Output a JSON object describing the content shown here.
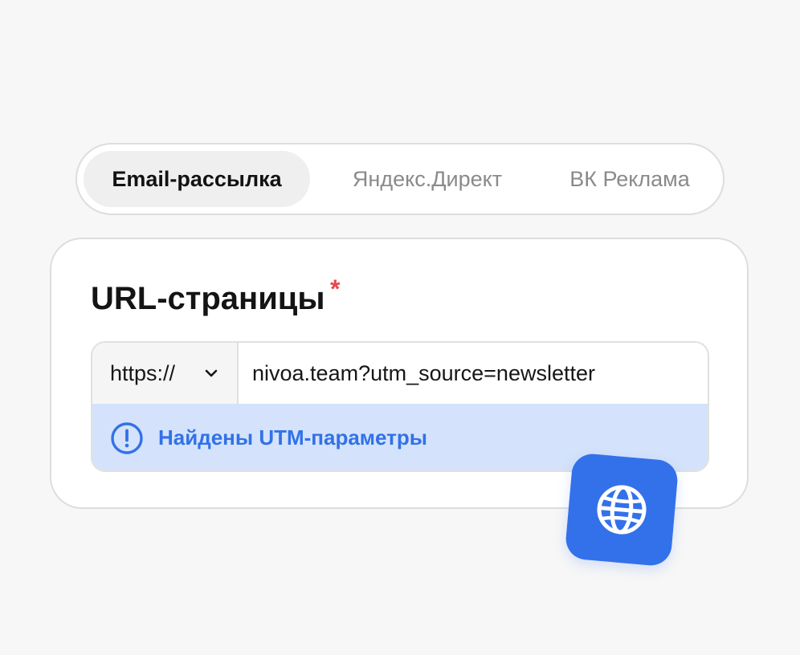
{
  "tabs": [
    {
      "label": "Email-рассылка",
      "active": true
    },
    {
      "label": "Яндекс.Директ",
      "active": false
    },
    {
      "label": "ВК Реклама",
      "active": false
    }
  ],
  "form": {
    "label": "URL-страницы",
    "required_mark": "*",
    "protocol": {
      "selected": "https://",
      "icon": "chevron-down-icon"
    },
    "url": {
      "value": "nivoa.team?utm_source=newsletter",
      "placeholder": ""
    },
    "notice": {
      "icon": "exclamation-circle-icon",
      "text": "Найдены UTM-параметры"
    }
  },
  "badge": {
    "icon": "globe-icon"
  },
  "colors": {
    "accent": "#3371ea",
    "notice_bg": "#d4e3fb",
    "notice_text": "#3271e8",
    "required": "#e5484d",
    "page_bg": "#f7f7f7"
  }
}
